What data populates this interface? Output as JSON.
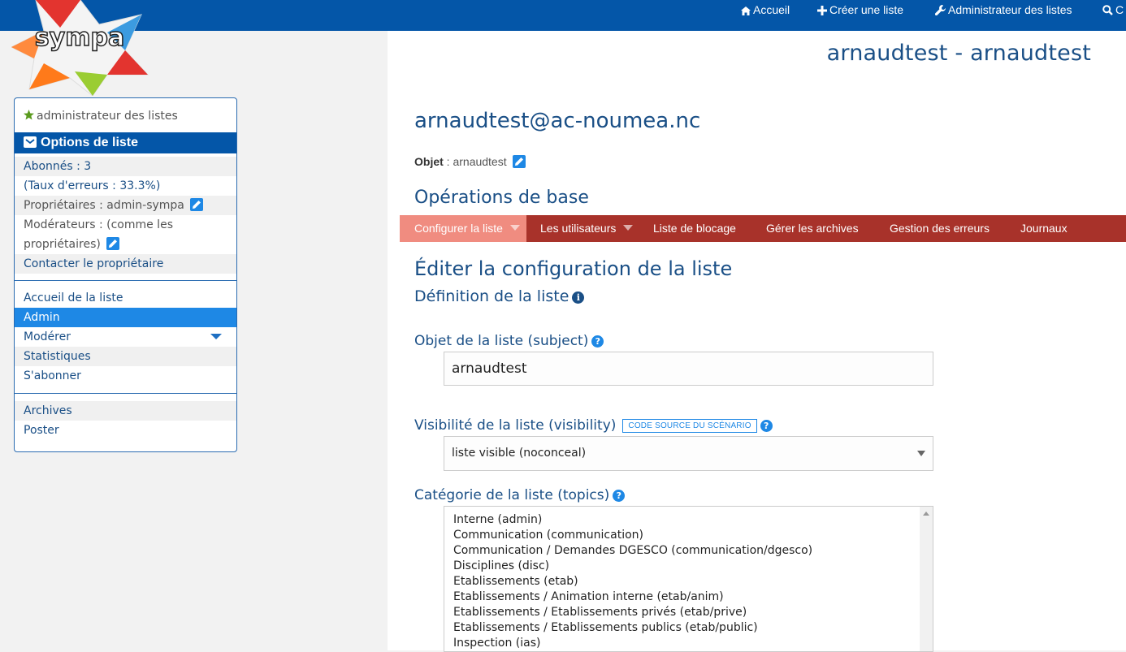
{
  "topnav": {
    "home": "Accueil",
    "create_list": "Créer une liste",
    "list_admin": "Administrateur des listes",
    "cut_item": "C"
  },
  "logo": {
    "text": "sympa"
  },
  "site_title": "arnaudtest - arnaudtest",
  "list": {
    "address": "arnaudtest@ac-noumea.nc",
    "subject_label": "Objet",
    "subject_sep": " : ",
    "subject_value": "arnaudtest"
  },
  "ops_title": "Opérations de base",
  "tabs": [
    {
      "label": "Configurer la liste",
      "has_menu": true,
      "active": true
    },
    {
      "label": "Les utilisateurs",
      "has_menu": true,
      "active": false
    },
    {
      "label": "Liste de blocage",
      "has_menu": false,
      "active": false
    },
    {
      "label": "Gérer les archives",
      "has_menu": false,
      "active": false
    },
    {
      "label": "Gestion des erreurs",
      "has_menu": false,
      "active": false
    },
    {
      "label": "Journaux",
      "has_menu": false,
      "active": false
    }
  ],
  "edit_title": "Éditer la configuration de la liste",
  "definition_title": "Définition de la liste",
  "fields": {
    "subject": {
      "label": "Objet de la liste (subject)",
      "value": "arnaudtest"
    },
    "visibility": {
      "label": "Visibilité de la liste (visibility)",
      "scenario_button": "CODE SOURCE DU SCÉNARIO",
      "value": "liste visible (noconceal)"
    },
    "topics": {
      "label": "Catégorie de la liste (topics)",
      "options": [
        "Interne (admin)",
        "Communication (communication)",
        "Communication / Demandes DGESCO (communication/dgesco)",
        "Disciplines (disc)",
        "Etablissements (etab)",
        "Etablissements / Animation interne (etab/anim)",
        "Etablissements / Etablissements privés (etab/prive)",
        "Etablissements / Etablissements publics (etab/public)",
        "Inspection (ias)"
      ]
    }
  },
  "sidebar": {
    "role": "administrateur des listes",
    "header": "Options de liste",
    "info": {
      "subscribers": "Abonnés : 3",
      "error_rate": "(Taux d'erreurs : 33.3%)",
      "owners": "Propriétaires : admin-sympa",
      "moderators_line1": "Modérateurs : (comme les",
      "moderators_line2": "propriétaires)",
      "contact": "Contacter le propriétaire"
    },
    "nav": {
      "home": "Accueil de la liste",
      "admin": "Admin",
      "moderate": "Modérer",
      "stats": "Statistiques",
      "subscribe": "S'abonner",
      "archives": "Archives",
      "post": "Poster"
    }
  },
  "colors": {
    "brand_blue": "#0456a8",
    "tab_bar": "#a8322a",
    "tab_active": "#f08c80",
    "link_blue": "#1a4f86",
    "accent": "#1e88e5"
  }
}
